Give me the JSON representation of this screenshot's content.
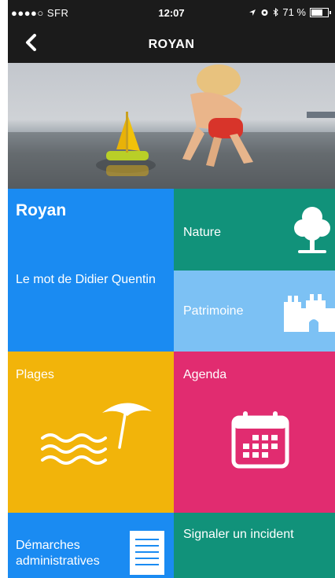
{
  "status": {
    "carrier": "●●●●○ SFR",
    "time": "12:07",
    "battery": "71 %"
  },
  "nav": {
    "title": "ROYAN"
  },
  "tiles": {
    "royan": {
      "title": "Royan",
      "subtitle": "Le mot de Didier Quentin"
    },
    "nature": {
      "label": "Nature"
    },
    "patrimoine": {
      "label": "Patrimoine"
    },
    "plages": {
      "label": "Plages"
    },
    "agenda": {
      "label": "Agenda"
    },
    "demarches": {
      "label": "Démarches administratives"
    },
    "signaler": {
      "label": "Signaler un incident"
    }
  },
  "colors": {
    "blue": "#1a8bf2",
    "green": "#11927a",
    "light_blue": "#7cc1f4",
    "yellow": "#f2b40a",
    "pink": "#e12c70",
    "bar": "#1b1b1b"
  },
  "icons": [
    "back-chevron-icon",
    "tree-icon",
    "castle-icon",
    "beach-umbrella-waves-icon",
    "calendar-icon",
    "document-icon"
  ]
}
